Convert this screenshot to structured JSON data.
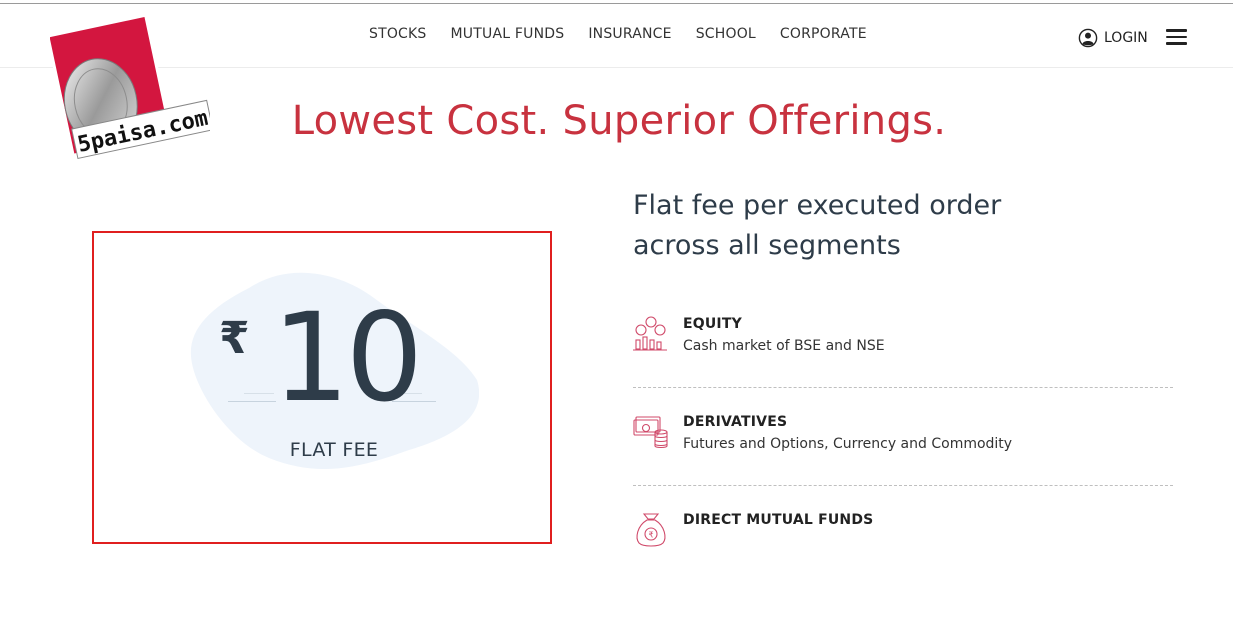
{
  "brand": {
    "logo_text": "5paisa.com"
  },
  "nav": {
    "items": [
      {
        "label": "STOCKS"
      },
      {
        "label": "MUTUAL FUNDS"
      },
      {
        "label": "INSURANCE"
      },
      {
        "label": "SCHOOL"
      },
      {
        "label": "CORPORATE"
      }
    ]
  },
  "header": {
    "login_label": "LOGIN"
  },
  "hero": {
    "headline": "Lowest Cost. Superior Offerings."
  },
  "fee": {
    "currency_symbol": "₹",
    "amount": "10",
    "label": "FLAT FEE"
  },
  "details": {
    "heading_line1": "Flat fee per executed order",
    "heading_line2": "across all segments",
    "segments": [
      {
        "title": "EQUITY",
        "description": "Cash market of BSE and NSE",
        "icon": "equity-icon"
      },
      {
        "title": "DERIVATIVES",
        "description": "Futures and Options, Currency and Commodity",
        "icon": "derivatives-icon"
      },
      {
        "title": "DIRECT MUTUAL FUNDS",
        "description": "",
        "icon": "money-bag-icon"
      }
    ]
  },
  "colors": {
    "accent": "#c8323f",
    "text": "#2e3c49",
    "highlight_border": "#e01f1f",
    "icon": "#d04a6a"
  }
}
